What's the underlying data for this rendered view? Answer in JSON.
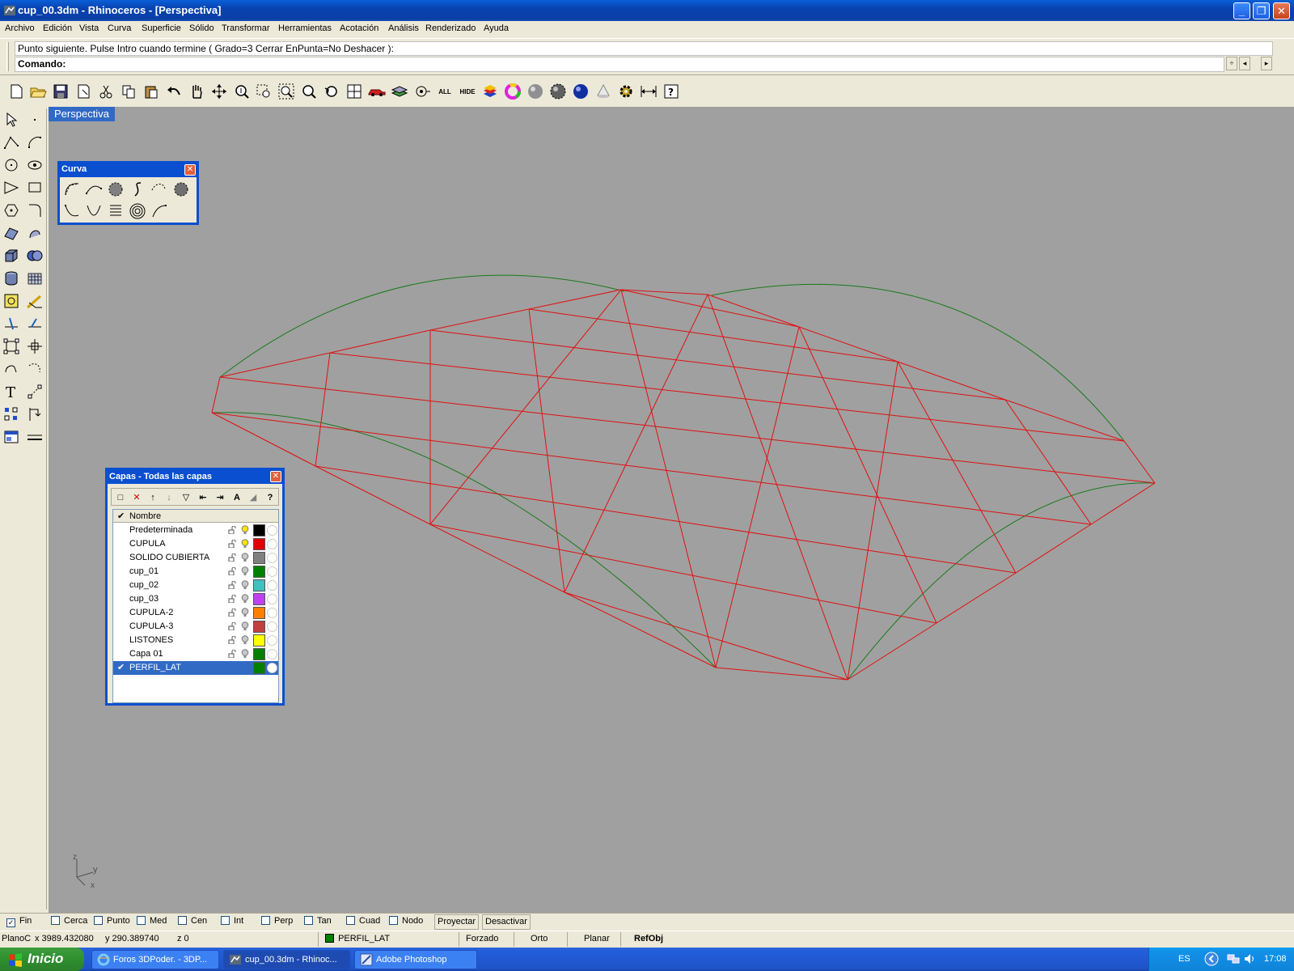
{
  "window": {
    "title": "cup_00.3dm - Rhinoceros - [Perspectiva]",
    "minimize_label": "_",
    "restore_label": "❐",
    "close_label": "✕"
  },
  "menu": {
    "items": [
      "Archivo",
      "Edición",
      "Vista",
      "Curva",
      "Superficie",
      "Sólido",
      "Transformar",
      "Herramientas",
      "Acotación",
      "Análisis",
      "Renderizado",
      "Ayuda"
    ]
  },
  "command": {
    "history": "Punto siguiente. Pulse Intro cuando termine ( Grado=3  Cerrar  EnPunta=No  Deshacer ):",
    "prompt": "Comando:"
  },
  "main_toolbar": {
    "icons": [
      "new-icon",
      "open-icon",
      "save-icon",
      "print-icon",
      "cut-icon",
      "copy-icon",
      "paste-icon",
      "undo-icon",
      "pan-icon",
      "rotate-view-icon",
      "zoom-dynamic-icon",
      "zoom-window-icon",
      "zoom-extents-icon",
      "zoom-selected-icon",
      "undo-view-icon",
      "four-viewports-icon",
      "car-icon",
      "layers-icon",
      "show-icon",
      "hide-icon",
      "layer-stack-icon",
      "color-wheel-icon",
      "gray-sphere-icon",
      "render-sphere-icon",
      "blue-sphere-icon",
      "light-cone-icon",
      "gear-icon",
      "dimension-icon",
      "help-icon"
    ],
    "all_label": "ALL",
    "hide_label": "HIDE"
  },
  "viewport": {
    "title": "Perspectiva",
    "axis_z": "z",
    "axis_y": "y",
    "axis_x": "x",
    "bg_color": "#a0a0a0",
    "mesh_color": "#e01010",
    "profile_color": "#1a7a1a"
  },
  "curva_panel": {
    "title": "Curva",
    "close_label": "✕"
  },
  "layers_panel": {
    "title": "Capas - Todas las capas",
    "close_label": "✕",
    "column_name": "Nombre",
    "toolbar_labels": [
      "□",
      "✕",
      "↑",
      "↓",
      "▽",
      "⇤",
      "⇥",
      "A",
      "◢",
      "?"
    ],
    "layers": [
      {
        "name": "Predeterminada",
        "color": "#000000",
        "light_on": true,
        "current": false
      },
      {
        "name": "CUPULA",
        "color": "#e00000",
        "light_on": true,
        "current": false
      },
      {
        "name": "SOLIDO CUBIERTA",
        "color": "#808080",
        "light_on": false,
        "current": false
      },
      {
        "name": "cup_01",
        "color": "#008000",
        "light_on": false,
        "current": false
      },
      {
        "name": "cup_02",
        "color": "#40c0c0",
        "light_on": false,
        "current": false
      },
      {
        "name": "cup_03",
        "color": "#c040f0",
        "light_on": false,
        "current": false
      },
      {
        "name": "CUPULA-2",
        "color": "#ff8000",
        "light_on": false,
        "current": false
      },
      {
        "name": "CUPULA-3",
        "color": "#c04040",
        "light_on": false,
        "current": false
      },
      {
        "name": "LISTONES",
        "color": "#ffff00",
        "light_on": false,
        "current": false
      },
      {
        "name": "Capa 01",
        "color": "#008000",
        "light_on": false,
        "current": false
      },
      {
        "name": "PERFIL_LAT",
        "color": "#008000",
        "light_on": false,
        "current": true
      }
    ]
  },
  "osnap": {
    "items": [
      {
        "label": "Fin",
        "checked": true
      },
      {
        "label": "Cerca",
        "checked": false
      },
      {
        "label": "Punto",
        "checked": false
      },
      {
        "label": "Med",
        "checked": false
      },
      {
        "label": "Cen",
        "checked": false
      },
      {
        "label": "Int",
        "checked": false
      },
      {
        "label": "Perp",
        "checked": false
      },
      {
        "label": "Tan",
        "checked": false
      },
      {
        "label": "Cuad",
        "checked": false
      },
      {
        "label": "Nodo",
        "checked": false
      }
    ],
    "project_label": "Proyectar",
    "disable_label": "Desactivar"
  },
  "status": {
    "plane": "PlanoC",
    "x": "x 3989.432080",
    "y": "y 290.389740",
    "z": "z 0",
    "current_layer": "PERFIL_LAT",
    "current_layer_color": "#008000",
    "forzado": "Forzado",
    "orto": "Orto",
    "planar": "Planar",
    "refobj": "RefObj"
  },
  "taskbar": {
    "start_label": "Inicio",
    "tasks": [
      {
        "label": "Foros 3DPoder. - 3DP...",
        "active": false
      },
      {
        "label": "cup_00.3dm - Rhinoc...",
        "active": true
      },
      {
        "label": "Adobe Photoshop",
        "active": false
      }
    ],
    "language": "ES",
    "clock": "17:08"
  }
}
